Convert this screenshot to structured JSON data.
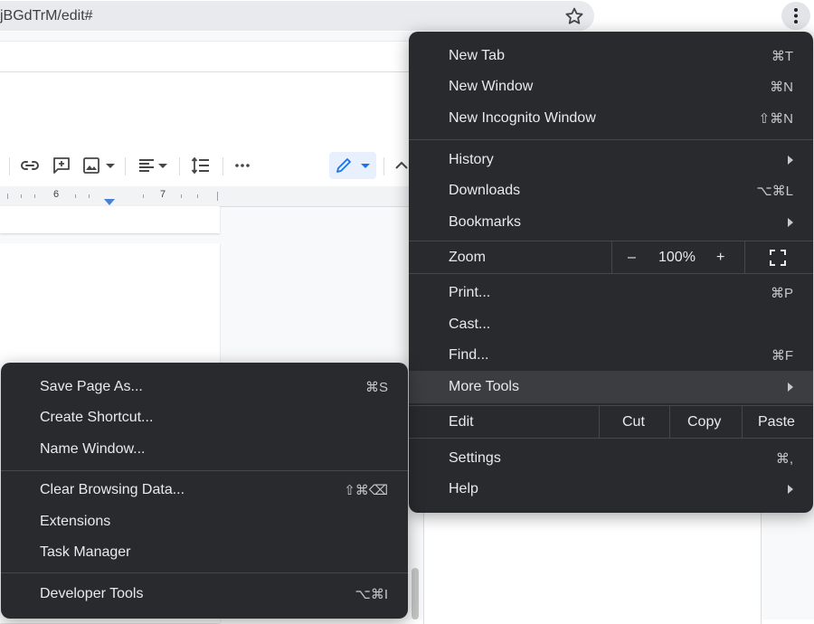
{
  "browser": {
    "url_text": "jBGdTrM/edit#"
  },
  "docs": {
    "ruler_numbers": [
      "6",
      "7"
    ]
  },
  "main_menu": {
    "new_tab": {
      "label": "New Tab",
      "shortcut": "⌘T"
    },
    "new_window": {
      "label": "New Window",
      "shortcut": "⌘N"
    },
    "new_incognito": {
      "label": "New Incognito Window",
      "shortcut": "⇧⌘N"
    },
    "history": {
      "label": "History"
    },
    "downloads": {
      "label": "Downloads",
      "shortcut": "⌥⌘L"
    },
    "bookmarks": {
      "label": "Bookmarks"
    },
    "zoom": {
      "label": "Zoom",
      "minus": "–",
      "level": "100%",
      "plus": "+"
    },
    "print": {
      "label": "Print...",
      "shortcut": "⌘P"
    },
    "cast": {
      "label": "Cast..."
    },
    "find": {
      "label": "Find...",
      "shortcut": "⌘F"
    },
    "more_tools": {
      "label": "More Tools"
    },
    "edit": {
      "label": "Edit",
      "cut": "Cut",
      "copy": "Copy",
      "paste": "Paste"
    },
    "settings": {
      "label": "Settings",
      "shortcut": "⌘,"
    },
    "help": {
      "label": "Help"
    }
  },
  "sub_menu": {
    "save_page": {
      "label": "Save Page As...",
      "shortcut": "⌘S"
    },
    "create_shortcut": {
      "label": "Create Shortcut..."
    },
    "name_window": {
      "label": "Name Window..."
    },
    "clear_data": {
      "label": "Clear Browsing Data...",
      "shortcut": "⇧⌘⌫"
    },
    "extensions": {
      "label": "Extensions"
    },
    "task_manager": {
      "label": "Task Manager"
    },
    "developer_tools": {
      "label": "Developer Tools",
      "shortcut": "⌥⌘I"
    }
  },
  "colors": {
    "menu_bg": "#292a2d",
    "menu_text": "#e8eaed",
    "highlight": "#3c3d41",
    "docs_accent": "#4a7fd6"
  }
}
